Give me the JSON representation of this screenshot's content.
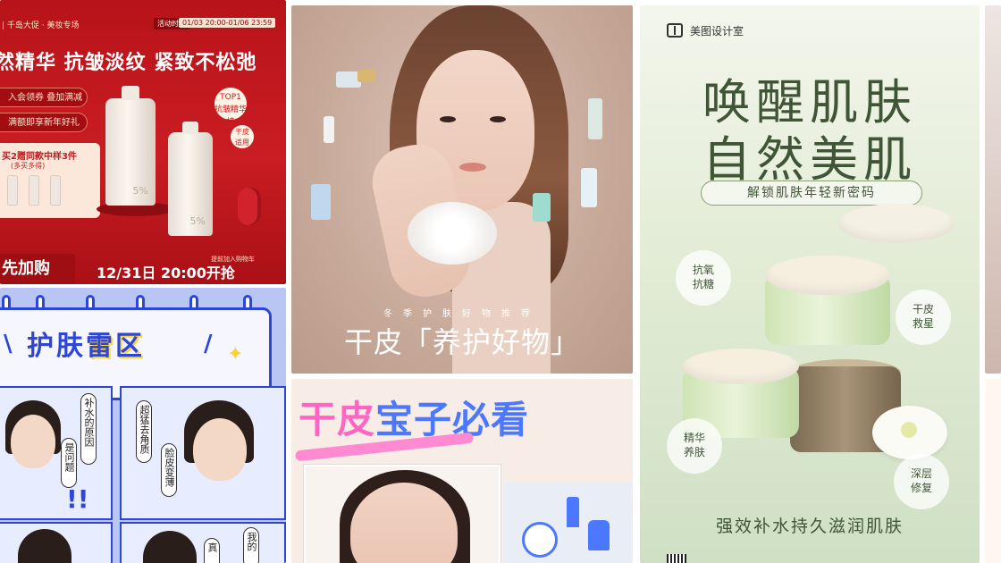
{
  "cards": {
    "c1": {
      "brand": "| 千岛大促 · 美妆专场",
      "tag": "活动时间",
      "time": "01/03 20:00-01/06 23:59",
      "headline": "然精华 抗皱淡纹 紧致不松弛",
      "perk1": "入会领券 叠加满减",
      "perk2": "满额即享新年好礼",
      "promo_title": "买2赠同款中样3件",
      "promo_sub": "(多买多得)",
      "badge": "TOP1\n抗皱精华榜",
      "skin": "干皮\n适用",
      "pct1": "5%",
      "pct2": "5%",
      "addcart": "先加购",
      "date": "12/31日 20:00开抢",
      "cartnote": "提前加入购物车"
    },
    "c2": {
      "title_a": "护肤",
      "title_b": "雷区",
      "slash_left": "\\",
      "slash_right": "/",
      "spark": "✦",
      "bubble1": "补水的原因",
      "bubble2": "是问题",
      "bubble3": "超猛去角质",
      "bubble4": "脸皮变薄",
      "bubble5": "我的",
      "bubble6": "真",
      "excl": "!!"
    },
    "c3": {
      "sub": "冬季护肤好物推荐",
      "main": "干皮「养护好物」"
    },
    "c4": {
      "t1": "干皮",
      "t2": "宝子必看"
    },
    "c5": {
      "brand": "美图设计室",
      "h1": "唤醒肌肤",
      "h2": "自然美肌",
      "pill": "解锁肌肤年轻新密码",
      "circle1": "抗氧\n抗糖",
      "circle2": "干皮\n救星",
      "circle3": "精华\n养肤",
      "circle4": "深层\n修复",
      "foot": "强效补水持久滋润肌肤"
    }
  },
  "colors": {
    "red": "#c41b1f",
    "blue": "#2d46d6",
    "green_text": "#3f5536",
    "pink": "#ff66c4"
  }
}
